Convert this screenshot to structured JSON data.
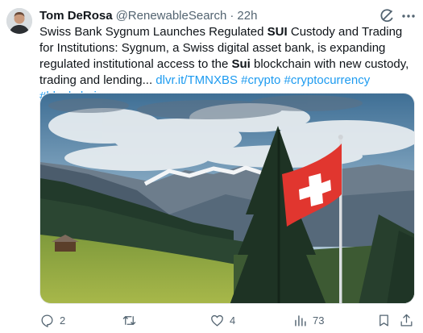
{
  "tweet": {
    "author_name": "Tom DeRosa",
    "author_handle": "@RenewableSearch",
    "separator": "·",
    "time": "22h",
    "text": {
      "part1": "Swiss Bank Sygnum Launches Regulated ",
      "bold1": "SUI",
      "part2": " Custody and Trading for Institutions: Sygnum, a Swiss digital asset bank, is expanding regulated institutional access to the ",
      "bold2": "Sui",
      "part3": " blockchain with new custody, trading and lending... ",
      "link": "dlvr.it/TMNXBS",
      "hashtags": [
        "#crypto",
        "#cryptocurrency",
        "#blockchain"
      ]
    }
  },
  "actions": {
    "reply_count": "2",
    "repost_count": "",
    "like_count": "4",
    "views_count": "73"
  },
  "icons": {
    "header": [
      "grok-icon",
      "more-icon"
    ],
    "actions": [
      "reply-icon",
      "repost-icon",
      "like-icon",
      "views-icon",
      "bookmark-icon",
      "share-icon"
    ]
  },
  "colors": {
    "link": "#1d9bf0",
    "secondary_text": "#536471",
    "primary_text": "#0f1419",
    "flag_red": "#e1362f"
  }
}
